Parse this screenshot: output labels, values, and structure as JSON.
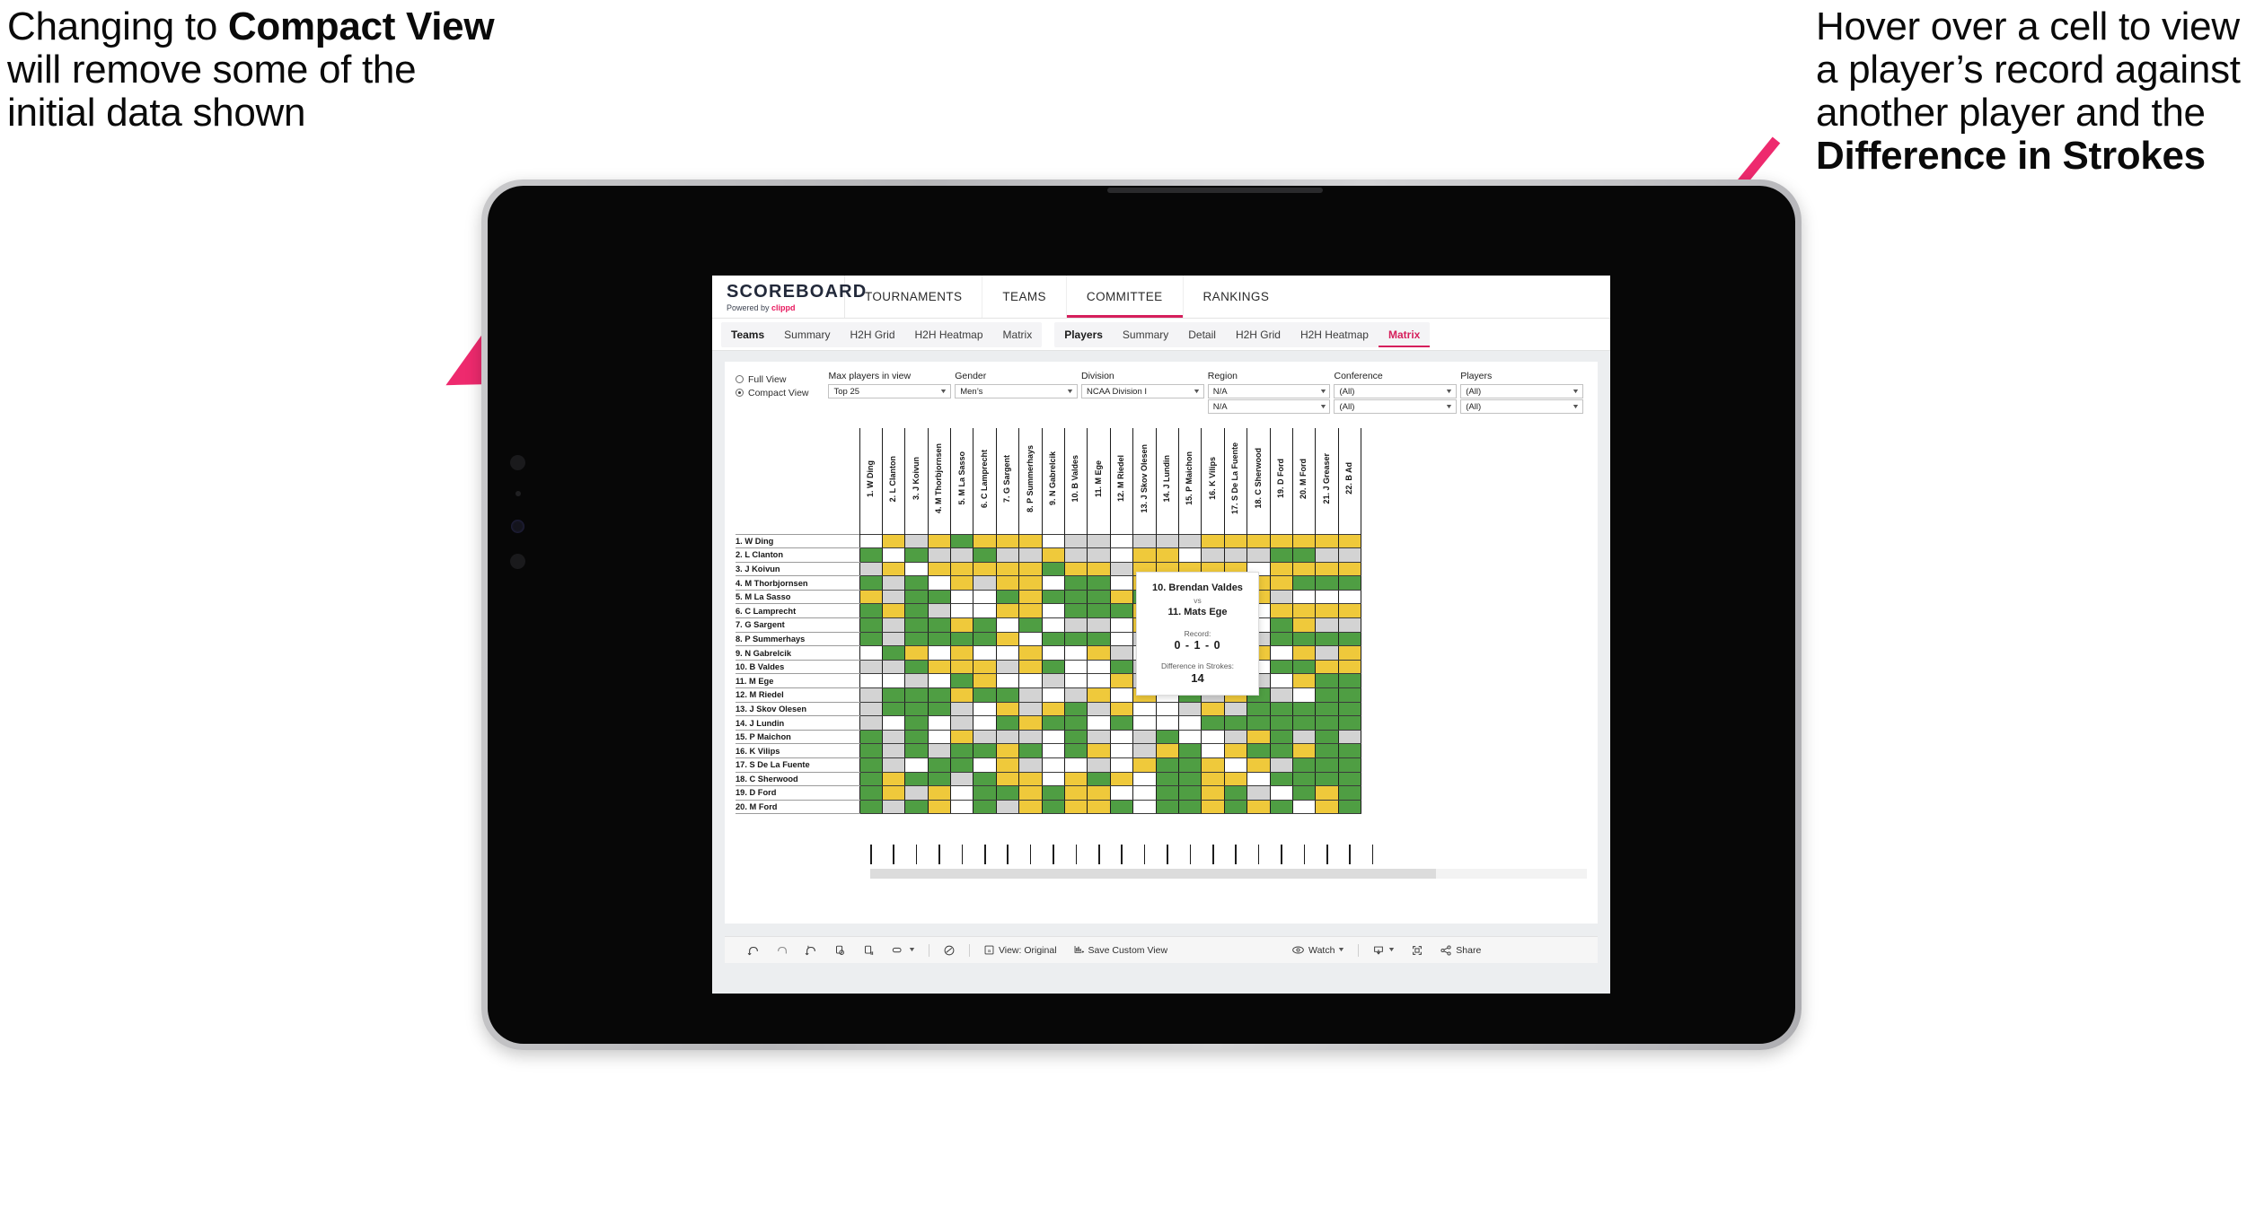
{
  "annotations": {
    "left": {
      "part1": "Changing to ",
      "bold": "Compact View",
      "part2": " will remove some of the initial data shown"
    },
    "right": {
      "part1": "Hover over a cell to view a player’s record against another player and the ",
      "bold": "Difference in Strokes",
      "part2": ""
    },
    "arrow_color": "#ee2a6e"
  },
  "app": {
    "brand": {
      "title": "SCOREBOARD",
      "sub_prefix": "Powered by ",
      "sub_brand": "clippd"
    },
    "topnav": [
      {
        "label": "TOURNAMENTS",
        "active": false
      },
      {
        "label": "TEAMS",
        "active": false
      },
      {
        "label": "COMMITTEE",
        "active": true
      },
      {
        "label": "RANKINGS",
        "active": false
      }
    ],
    "subtabs_group_1": [
      "Teams",
      "Summary",
      "H2H Grid",
      "H2H Heatmap",
      "Matrix"
    ],
    "subtabs_group_2": [
      "Players",
      "Summary",
      "Detail",
      "H2H Grid",
      "H2H Heatmap",
      "Matrix"
    ],
    "selected_subtab": "Matrix"
  },
  "filters": {
    "view_mode": {
      "full_label": "Full View",
      "compact_label": "Compact View",
      "selected": "Compact View"
    },
    "controls": [
      {
        "label": "Max players in view",
        "value": "Top 25",
        "value2": null
      },
      {
        "label": "Gender",
        "value": "Men’s",
        "value2": null
      },
      {
        "label": "Division",
        "value": "NCAA Division I",
        "value2": null
      },
      {
        "label": "Region",
        "value": "N/A",
        "value2": "N/A"
      },
      {
        "label": "Conference",
        "value": "(All)",
        "value2": "(All)"
      },
      {
        "label": "Players",
        "value": "(All)",
        "value2": "(All)"
      }
    ]
  },
  "matrix": {
    "row_labels": [
      "1. W Ding",
      "2. L Clanton",
      "3. J Koivun",
      "4. M Thorbjornsen",
      "5. M La Sasso",
      "6. C Lamprecht",
      "7. G Sargent",
      "8. P Summerhays",
      "9. N Gabrelcik",
      "10. B Valdes",
      "11. M Ege",
      "12. M Riedel",
      "13. J Skov Olesen",
      "14. J Lundin",
      "15. P Maichon",
      "16. K Vilips",
      "17. S De La Fuente",
      "18. C Sherwood",
      "19. D Ford",
      "20. M Ford"
    ],
    "column_labels": [
      "1. W Ding",
      "2. L Clanton",
      "3. J Koivun",
      "4. M Thorbjornsen",
      "5. M La Sasso",
      "6. C Lamprecht",
      "7. G Sargent",
      "8. P Summerhays",
      "9. N Gabrelcik",
      "10. B Valdes",
      "11. M Ege",
      "12. M Riedel",
      "13. J Skov Olesen",
      "14. J Lundin",
      "15. P Maichon",
      "16. K Vilips",
      "17. S De La Fuente",
      "18. C Sherwood",
      "19. D Ford",
      "20. M Ford",
      "21. J Greaser",
      "22. B Ad"
    ],
    "legend_colors": {
      "win": "#4f9e43",
      "loss": "#efc93b",
      "tie": "#d3d3d3",
      "none": "#ffffff"
    },
    "cells": [
      [
        "x",
        "y",
        "a",
        "y",
        "g",
        "y",
        "y",
        "y",
        "w",
        "a",
        "a",
        "w",
        "a",
        "a",
        "a",
        "y",
        "y",
        "y",
        "y",
        "y",
        "y",
        "y"
      ],
      [
        "g",
        "x",
        "g",
        "a",
        "a",
        "g",
        "a",
        "a",
        "y",
        "a",
        "a",
        "w",
        "y",
        "y",
        "w",
        "a",
        "a",
        "a",
        "g",
        "g",
        "a",
        "a"
      ],
      [
        "a",
        "y",
        "x",
        "y",
        "y",
        "y",
        "y",
        "y",
        "g",
        "y",
        "y",
        "a",
        "y",
        "y",
        "y",
        "y",
        "y",
        "w",
        "y",
        "y",
        "y",
        "y"
      ],
      [
        "g",
        "a",
        "g",
        "x",
        "y",
        "a",
        "y",
        "y",
        "w",
        "g",
        "g",
        "w",
        "y",
        "y",
        "w",
        "w",
        "a",
        "y",
        "y",
        "g",
        "g",
        "g"
      ],
      [
        "y",
        "a",
        "g",
        "g",
        "x",
        "w",
        "g",
        "y",
        "g",
        "g",
        "g",
        "y",
        "g",
        "a",
        "a",
        "g",
        "y",
        "y",
        "a",
        "w",
        "w",
        "w"
      ],
      [
        "g",
        "y",
        "g",
        "a",
        "w",
        "x",
        "y",
        "y",
        "w",
        "g",
        "g",
        "g",
        "y",
        "w",
        "w",
        "a",
        "y",
        "w",
        "y",
        "y",
        "y",
        "y"
      ],
      [
        "g",
        "a",
        "g",
        "g",
        "y",
        "g",
        "x",
        "g",
        "w",
        "a",
        "a",
        "w",
        "y",
        "g",
        "y",
        "a",
        "g",
        "w",
        "g",
        "y",
        "a",
        "a"
      ],
      [
        "g",
        "a",
        "g",
        "g",
        "g",
        "g",
        "y",
        "x",
        "g",
        "g",
        "g",
        "w",
        "a",
        "a",
        "g",
        "a",
        "y",
        "a",
        "g",
        "g",
        "g",
        "g"
      ],
      [
        "w",
        "g",
        "y",
        "w",
        "y",
        "w",
        "w",
        "y",
        "x",
        "w",
        "y",
        "a",
        "w",
        "g",
        "y",
        "w",
        "w",
        "y",
        "w",
        "y",
        "a",
        "y"
      ],
      [
        "a",
        "a",
        "g",
        "y",
        "y",
        "y",
        "a",
        "y",
        "g",
        "x",
        "w",
        "g",
        "a",
        "y",
        "y",
        "y",
        "y",
        "w",
        "g",
        "g",
        "y",
        "y"
      ],
      [
        "w",
        "w",
        "a",
        "w",
        "g",
        "y",
        "w",
        "w",
        "a",
        "w",
        "x",
        "y",
        "a",
        "y",
        "a",
        "g",
        "w",
        "a",
        "w",
        "y",
        "g",
        "g"
      ],
      [
        "a",
        "g",
        "g",
        "g",
        "y",
        "g",
        "g",
        "a",
        "w",
        "a",
        "y",
        "x",
        "y",
        "w",
        "g",
        "a",
        "y",
        "g",
        "a",
        "w",
        "g",
        "g"
      ],
      [
        "a",
        "g",
        "g",
        "g",
        "a",
        "w",
        "y",
        "a",
        "y",
        "g",
        "a",
        "y",
        "x",
        "w",
        "a",
        "y",
        "a",
        "g",
        "g",
        "g",
        "g",
        "g"
      ],
      [
        "a",
        "w",
        "g",
        "w",
        "a",
        "w",
        "g",
        "y",
        "g",
        "g",
        "w",
        "g",
        "w",
        "x",
        "w",
        "g",
        "g",
        "g",
        "g",
        "g",
        "g",
        "g"
      ],
      [
        "g",
        "a",
        "g",
        "w",
        "y",
        "a",
        "a",
        "a",
        "w",
        "g",
        "a",
        "w",
        "a",
        "g",
        "x",
        "w",
        "a",
        "y",
        "g",
        "a",
        "g",
        "a"
      ],
      [
        "g",
        "a",
        "g",
        "a",
        "g",
        "g",
        "y",
        "g",
        "w",
        "g",
        "y",
        "w",
        "a",
        "y",
        "g",
        "x",
        "y",
        "g",
        "g",
        "y",
        "g",
        "g"
      ],
      [
        "g",
        "a",
        "w",
        "g",
        "g",
        "w",
        "y",
        "a",
        "w",
        "w",
        "a",
        "w",
        "y",
        "g",
        "g",
        "y",
        "x",
        "y",
        "a",
        "g",
        "g",
        "g"
      ],
      [
        "g",
        "y",
        "g",
        "g",
        "a",
        "g",
        "y",
        "y",
        "w",
        "y",
        "g",
        "y",
        "w",
        "g",
        "g",
        "y",
        "y",
        "x",
        "g",
        "g",
        "g",
        "g"
      ],
      [
        "g",
        "y",
        "a",
        "y",
        "w",
        "g",
        "g",
        "y",
        "g",
        "y",
        "y",
        "w",
        "w",
        "g",
        "g",
        "y",
        "g",
        "a",
        "x",
        "g",
        "y",
        "g"
      ],
      [
        "g",
        "a",
        "g",
        "y",
        "w",
        "g",
        "a",
        "y",
        "g",
        "y",
        "y",
        "g",
        "w",
        "g",
        "g",
        "y",
        "g",
        "y",
        "g",
        "x",
        "y",
        "g"
      ]
    ]
  },
  "tooltip": {
    "player_1": "10. Brendan Valdes",
    "vs": "vs",
    "player_2": "11. Mats Ege",
    "record_label": "Record:",
    "record_value": "0 - 1 - 0",
    "difference_label": "Difference in Strokes:",
    "difference_value": "14"
  },
  "toolbar": {
    "view_label": "View: Original",
    "save_label": "Save Custom View",
    "watch_label": "Watch",
    "share_label": "Share"
  }
}
